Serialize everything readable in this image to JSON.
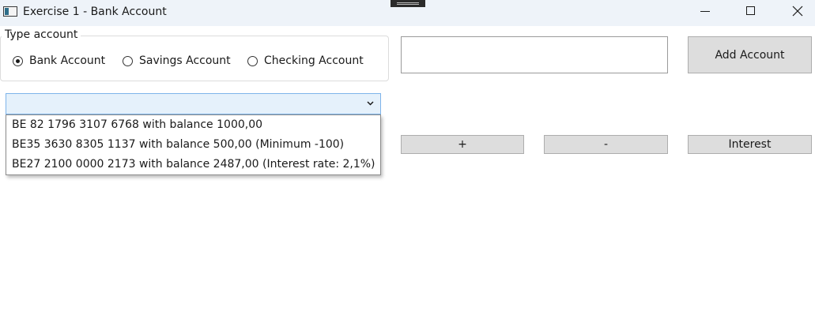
{
  "window": {
    "title": "Exercise 1 - Bank Account"
  },
  "type_account": {
    "label": "Type account",
    "options": [
      {
        "label": "Bank Account",
        "checked": true
      },
      {
        "label": "Savings Account",
        "checked": false
      },
      {
        "label": "Checking Account",
        "checked": false
      }
    ]
  },
  "account_input": {
    "value": ""
  },
  "buttons": {
    "add_account": "Add Account",
    "plus": "+",
    "minus": "-",
    "interest": "Interest"
  },
  "accounts_combo": {
    "selected": "",
    "items": [
      "BE 82 1796 3107 6768 with balance 1000,00",
      "BE35 3630 8305 1137 with balance 500,00 (Minimum -100)",
      "BE27 2100 0000 2173 with balance 2487,00 (Interest rate: 2,1%)"
    ]
  }
}
